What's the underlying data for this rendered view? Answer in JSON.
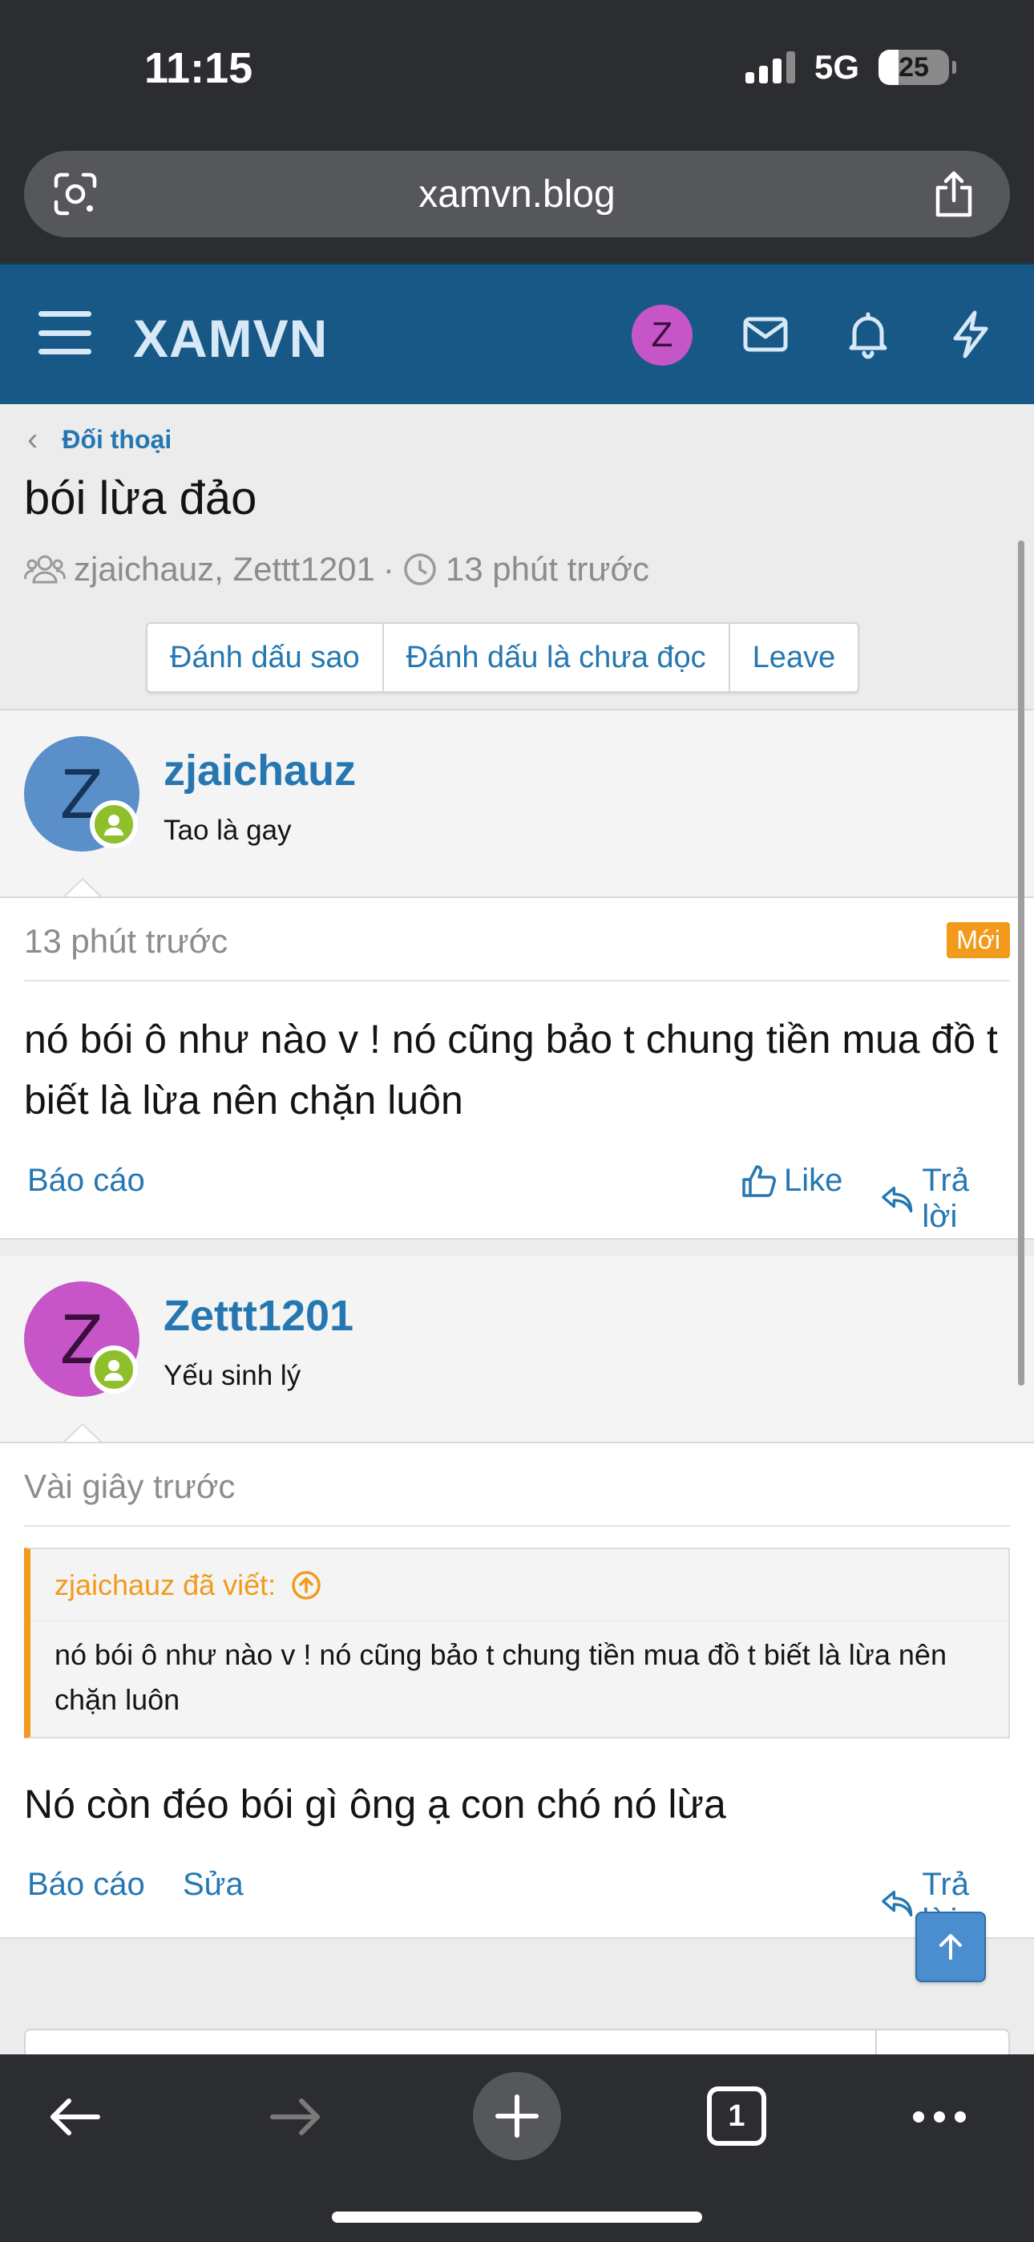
{
  "status_bar": {
    "time": "11:15",
    "network": "5G",
    "battery": "25"
  },
  "browser": {
    "url": "xamvn.blog",
    "tab_count": "1"
  },
  "site": {
    "logo": "XAMVN",
    "user_initial": "Z"
  },
  "breadcrumb": {
    "label": "Đối thoại"
  },
  "conversation": {
    "title": "bói lừa đảo",
    "participants": "zjaichauz, Zettt1201",
    "separator": "·",
    "time": "13 phút trước",
    "buttons": {
      "star": "Đánh dấu sao",
      "mark_unread": "Đánh dấu là chưa đọc",
      "leave": "Leave"
    }
  },
  "messages": [
    {
      "author": "zjaichauz",
      "user_title": "Tao là gay",
      "avatar_letter": "Z",
      "time": "13 phút trước",
      "badge": "Mới",
      "text": "nó bói ô như nào v ! nó cũng bảo t chung tiền mua đồ t biết là lừa nên chặn luôn",
      "actions": {
        "report": "Báo cáo",
        "like": "Like",
        "reply": "Trả lời"
      }
    },
    {
      "author": "Zettt1201",
      "user_title": "Yếu sinh lý",
      "avatar_letter": "Z",
      "time": "Vài giây trước",
      "quote": {
        "head": "zjaichauz đã viết:",
        "text": "nó bói ô như nào v ! nó cũng bảo t chung tiền mua đồ t biết là lừa nên chặn luôn"
      },
      "text": "Nó còn đéo bói gì ông ạ con chó nó lừa",
      "actions": {
        "report": "Báo cáo",
        "edit": "Sửa",
        "reply": "Trả lời"
      }
    }
  ],
  "colors": {
    "header_bg": "#185886",
    "link": "#2577b1",
    "badge_new": "#f29a1b",
    "avatar1": "#5b8fca",
    "avatar2": "#c655c8",
    "online": "#8fbf2a"
  }
}
